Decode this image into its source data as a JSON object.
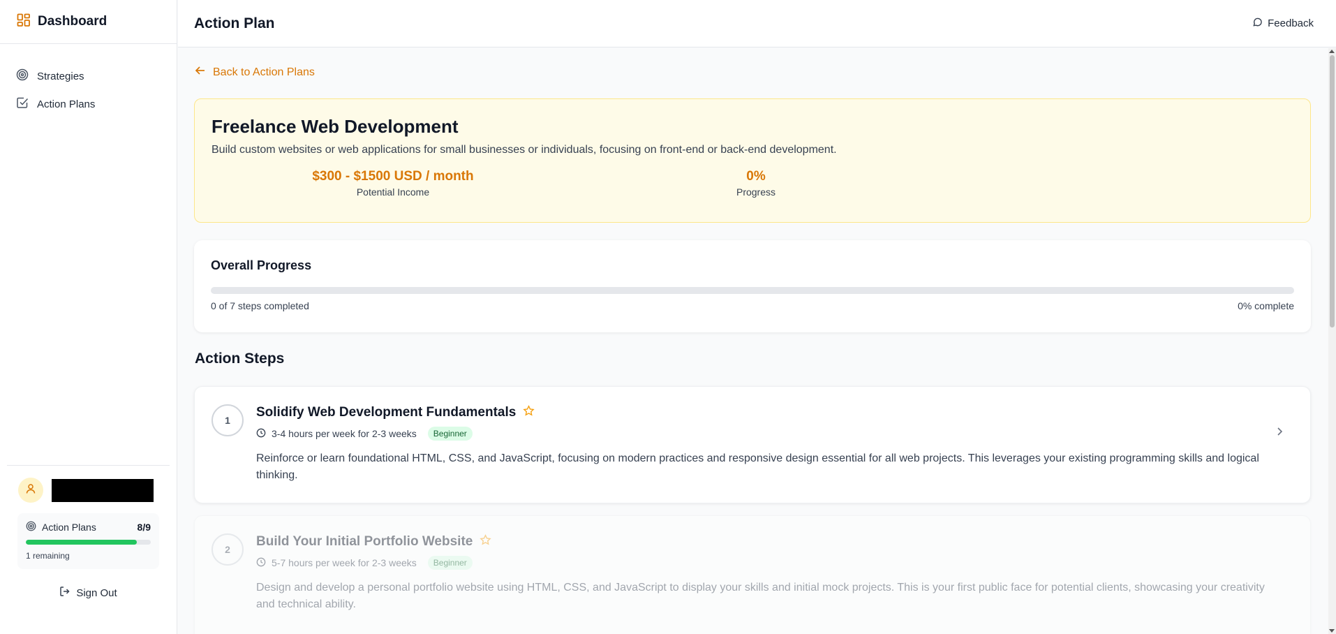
{
  "sidebar": {
    "brand": "Dashboard",
    "nav": [
      {
        "label": "Strategies",
        "icon": "target-icon"
      },
      {
        "label": "Action Plans",
        "icon": "checkbox-icon"
      }
    ],
    "usage": {
      "label": "Action Plans",
      "count": "8/9",
      "fraction": 0.889,
      "remaining": "1 remaining"
    },
    "sign_out": "Sign Out"
  },
  "header": {
    "title": "Action Plan",
    "feedback": "Feedback"
  },
  "main": {
    "back_link": "Back to Action Plans",
    "hero": {
      "title": "Freelance Web Development",
      "description": "Build custom websites or web applications for small businesses or individuals, focusing on front-end or back-end development.",
      "income_value": "$300 - $1500 USD / month",
      "income_label": "Potential Income",
      "progress_value": "0%",
      "progress_label": "Progress"
    },
    "overall": {
      "title": "Overall Progress",
      "fraction": 0,
      "steps_text": "0 of 7 steps completed",
      "complete_text": "0% complete"
    },
    "steps_title": "Action Steps",
    "steps": [
      {
        "number": "1",
        "title": "Solidify Web Development Fundamentals",
        "time": "3-4 hours per week for 2-3 weeks",
        "level": "Beginner",
        "description": "Reinforce or learn foundational HTML, CSS, and JavaScript, focusing on modern practices and responsive design essential for all web projects. This leverages your existing programming skills and logical thinking."
      },
      {
        "number": "2",
        "title": "Build Your Initial Portfolio Website",
        "time": "5-7 hours per week for 2-3 weeks",
        "level": "Beginner",
        "description": "Design and develop a personal portfolio website using HTML, CSS, and JavaScript to display your skills and initial mock projects. This is your first public face for potential clients, showcasing your creativity and technical ability."
      }
    ]
  },
  "colors": {
    "accent": "#d97706",
    "success": "#22c55e",
    "hero_bg": "#fefbe8"
  }
}
